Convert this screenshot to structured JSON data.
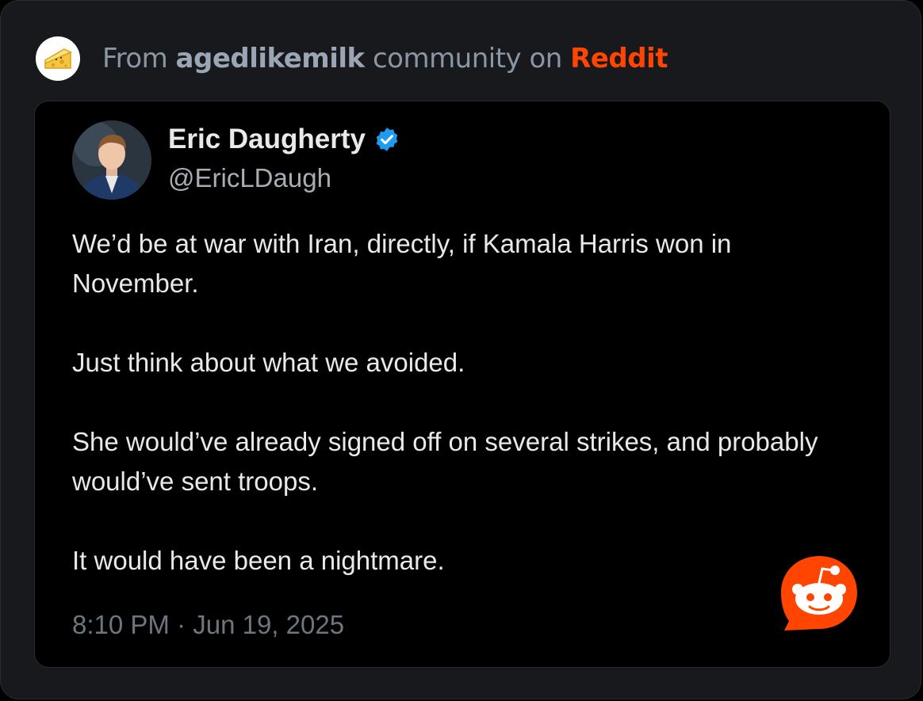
{
  "header": {
    "prefix": "From ",
    "community": "agedlikemilk",
    "middle": " community on ",
    "platform": "Reddit",
    "community_icon": "cheese-icon"
  },
  "post": {
    "author_name": "Eric Daugherty",
    "author_handle": "@EricLDaugh",
    "verified": true,
    "paragraphs": [
      "We’d be at war with Iran, directly, if Kamala Harris won in November.",
      "Just think about what we avoided.",
      "She would’ve already signed off on several strikes, and probably would’ve sent troops.",
      "It would have been a nightmare."
    ],
    "timestamp": "8:10 PM · Jun 19, 2025"
  },
  "colors": {
    "accent_reddit": "#ff4500",
    "verified_blue": "#1d9bf0"
  },
  "overlay_icon": "reddit-logo-icon"
}
